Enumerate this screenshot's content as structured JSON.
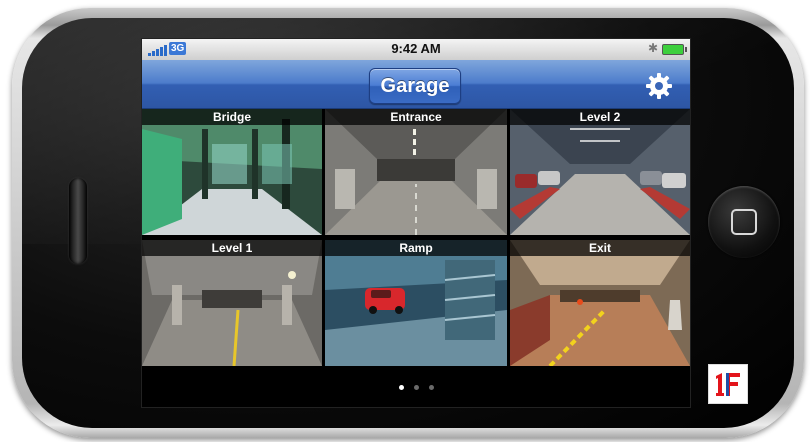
{
  "status_bar": {
    "network": "3G",
    "time": "9:42 AM",
    "icons": [
      "signal-icon",
      "bluetooth-icon",
      "battery-icon"
    ]
  },
  "nav": {
    "title": "Garage",
    "settings_icon": "gear-icon"
  },
  "cameras": [
    {
      "label": "Bridge"
    },
    {
      "label": "Entrance"
    },
    {
      "label": "Level 2"
    },
    {
      "label": "Level 1"
    },
    {
      "label": "Ramp"
    },
    {
      "label": "Exit"
    }
  ],
  "pager": {
    "pages": 3,
    "current": 1
  },
  "colors": {
    "nav_blue": "#3a66b8",
    "logo_red": "#e3141b",
    "logo_blue": "#1f4fa8"
  },
  "logo_icon": "brand-logo-icon"
}
